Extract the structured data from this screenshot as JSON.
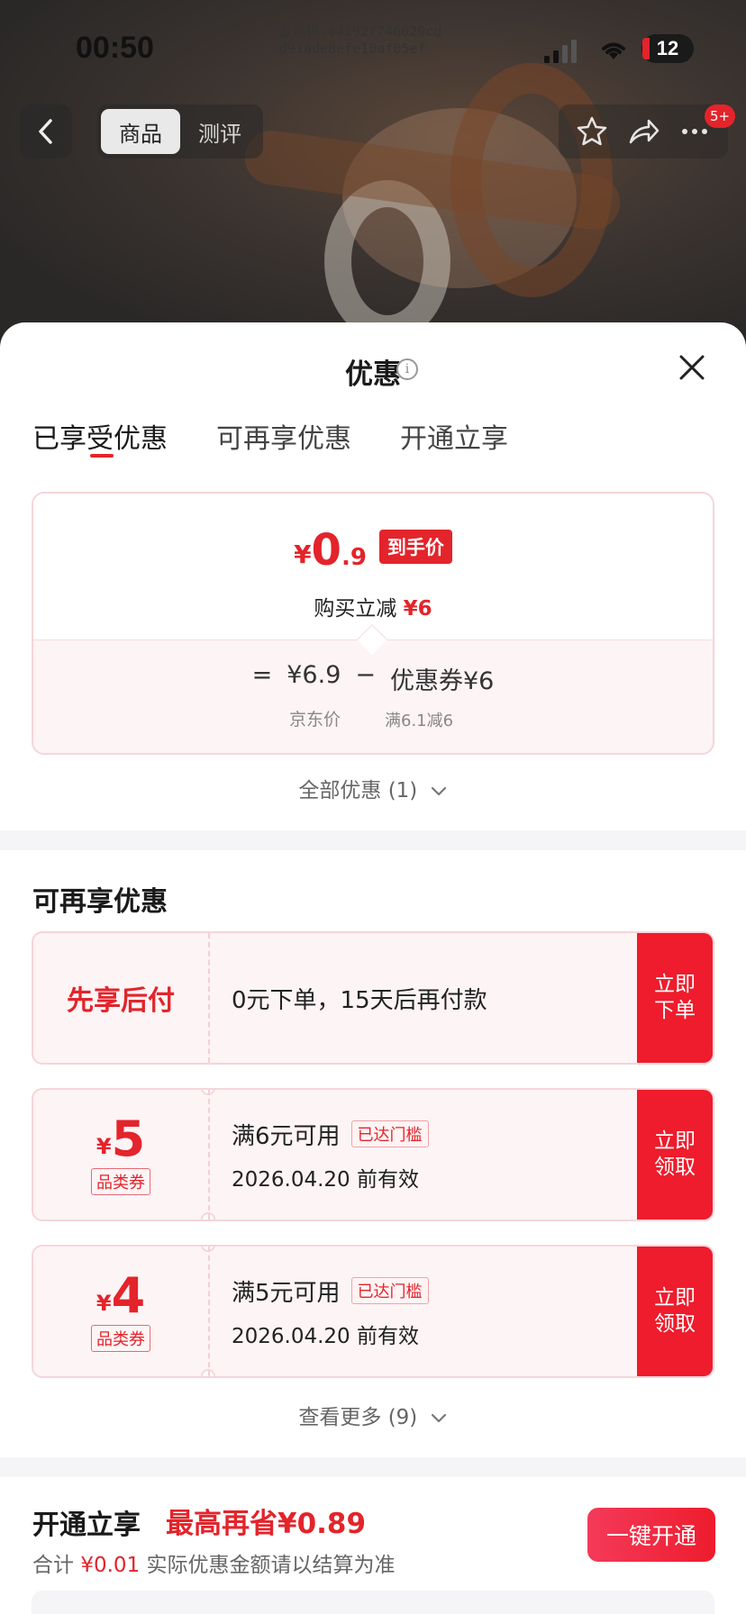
{
  "status": {
    "time": "00:50",
    "feedback_line1": "反馈码:04192f746029cd",
    "feedback_line2": "d91ade8efe10af05ef",
    "battery": "12"
  },
  "nav": {
    "seg_items": [
      "商品",
      "测评"
    ],
    "badge": "5+"
  },
  "sheet": {
    "title": "优惠",
    "tabs": [
      "已享受优惠",
      "可再享优惠",
      "开通立享"
    ]
  },
  "enjoyed": {
    "currency": "¥",
    "price_int": "0",
    "price_dec": ".9",
    "price_tag": "到手价",
    "reduce_label": "购买立减",
    "reduce_value": "¥6",
    "eq": "=",
    "jd_price": "¥6.9",
    "minus": "−",
    "coupon_label": "优惠券¥6",
    "jd_price_label": "京东价",
    "coupon_cond": "满6.1减6",
    "all_link": "全部优惠 (1)"
  },
  "more_offers": {
    "title": "可再享优惠",
    "bnpl": {
      "name": "先享后付",
      "desc": "0元下单，15天后再付款",
      "btn": "立即\n下单"
    },
    "coupons": [
      {
        "currency": "¥",
        "amount": "5",
        "tag": "品类券",
        "cond": "满6元可用",
        "reach": "已达门槛",
        "expiry": "2026.04.20 前有效",
        "btn": "立即\n领取"
      },
      {
        "currency": "¥",
        "amount": "4",
        "tag": "品类券",
        "cond": "满5元可用",
        "reach": "已达门槛",
        "expiry": "2026.04.20 前有效",
        "btn": "立即\n领取"
      }
    ],
    "more_link": "查看更多 (9)"
  },
  "open": {
    "title": "开通立享",
    "save": "最高再省¥0.89",
    "total_label": "合计",
    "total_value": "¥0.01",
    "note": "实际优惠金额请以结算为准",
    "btn": "一键开通"
  },
  "colors": {
    "accent": "#e3242b",
    "button_red": "#ee1c2c",
    "card_bg": "#fdf4f5"
  }
}
